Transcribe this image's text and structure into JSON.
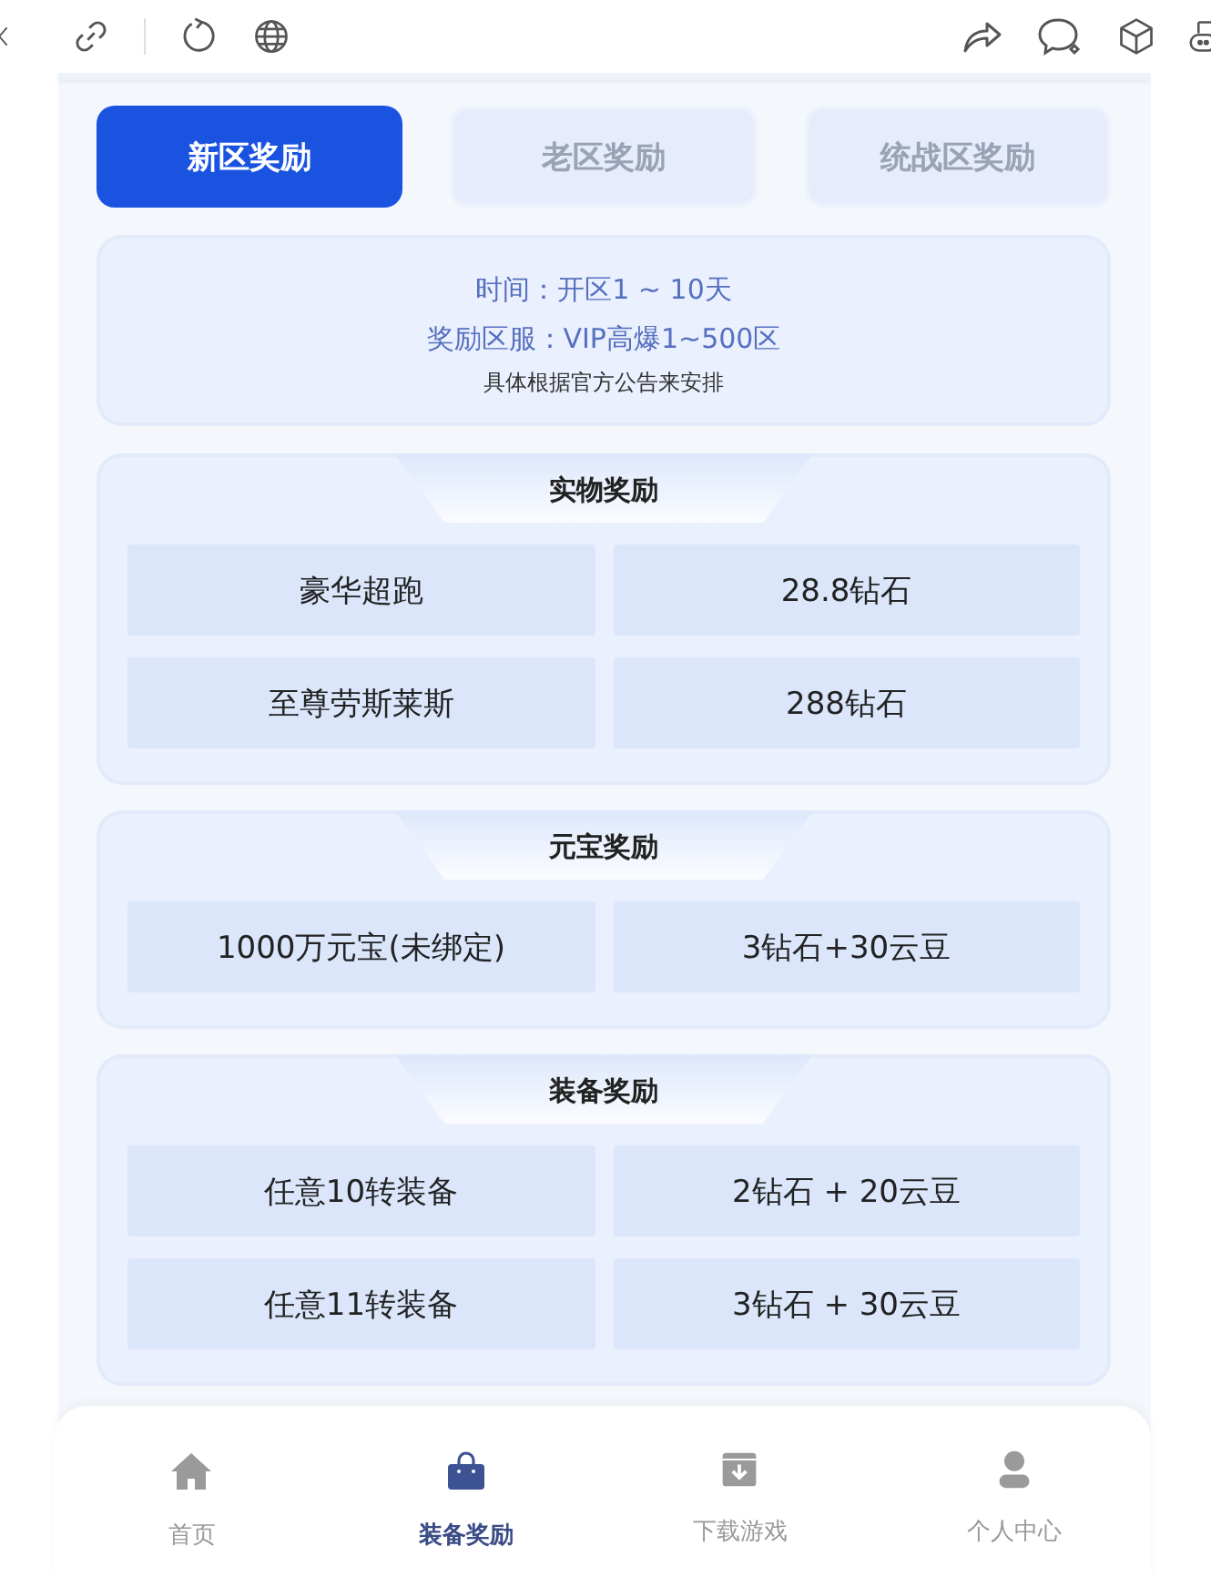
{
  "tabs": [
    {
      "label": "新区奖励",
      "selected": true
    },
    {
      "label": "老区奖励",
      "selected": false
    },
    {
      "label": "统战区奖励",
      "selected": false
    }
  ],
  "info": {
    "lines": [
      "时间：开区1 ~ 10天",
      "奖励区服：VIP高爆1~500区"
    ],
    "note": "具体根据官方公告来安排"
  },
  "sections": [
    {
      "title": "实物奖励",
      "rows": [
        [
          "豪华超跑",
          "28.8钻石"
        ],
        [
          "至尊劳斯莱斯",
          "288钻石"
        ]
      ]
    },
    {
      "title": "元宝奖励",
      "rows": [
        [
          "1000万元宝(未绑定)",
          "3钻石+30云豆"
        ]
      ]
    },
    {
      "title": "装备奖励",
      "rows": [
        [
          "任意10转装备",
          "2钻石 + 20云豆"
        ],
        [
          "任意11转装备",
          "3钻石 + 30云豆"
        ]
      ]
    }
  ],
  "bottom_nav": [
    {
      "kind": "home",
      "label": "首页",
      "selected": false
    },
    {
      "kind": "bag",
      "label": "装备奖励",
      "selected": true
    },
    {
      "kind": "download",
      "label": "下载游戏",
      "selected": false
    },
    {
      "kind": "user",
      "label": "个人中心",
      "selected": false
    }
  ]
}
